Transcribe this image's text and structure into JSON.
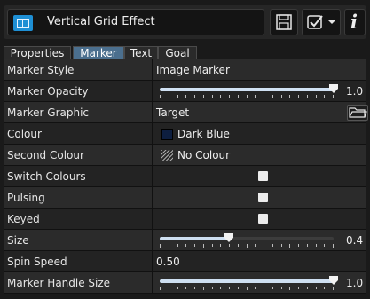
{
  "window": {
    "title": "Vertical Grid Effect"
  },
  "toolbar": {
    "info_label": "i"
  },
  "tabs": [
    {
      "label": "Properties",
      "active": false
    },
    {
      "label": "Marker",
      "active": true
    },
    {
      "label": "Text",
      "active": false
    },
    {
      "label": "Goal",
      "active": false
    }
  ],
  "properties": {
    "marker_style": {
      "label": "Marker Style",
      "value": "Image Marker"
    },
    "marker_opacity": {
      "label": "Marker Opacity",
      "value": "1.0",
      "level": 1.0
    },
    "marker_graphic": {
      "label": "Marker Graphic",
      "value": "Target"
    },
    "colour": {
      "label": "Colour",
      "value": "Dark Blue",
      "swatch": "#0d1e3f"
    },
    "second_colour": {
      "label": "Second Colour",
      "value": "No Colour"
    },
    "switch_colours": {
      "label": "Switch Colours"
    },
    "pulsing": {
      "label": "Pulsing"
    },
    "keyed": {
      "label": "Keyed"
    },
    "size": {
      "label": "Size",
      "value": "0.4",
      "level": 0.4
    },
    "spin_speed": {
      "label": "Spin Speed",
      "value": "0.50"
    },
    "marker_handle_size": {
      "label": "Marker Handle Size",
      "value": "1.0",
      "level": 1.0
    }
  },
  "colors": {
    "accent_tab": "#4b6f8e",
    "app_icon": "#1e8fd4"
  }
}
